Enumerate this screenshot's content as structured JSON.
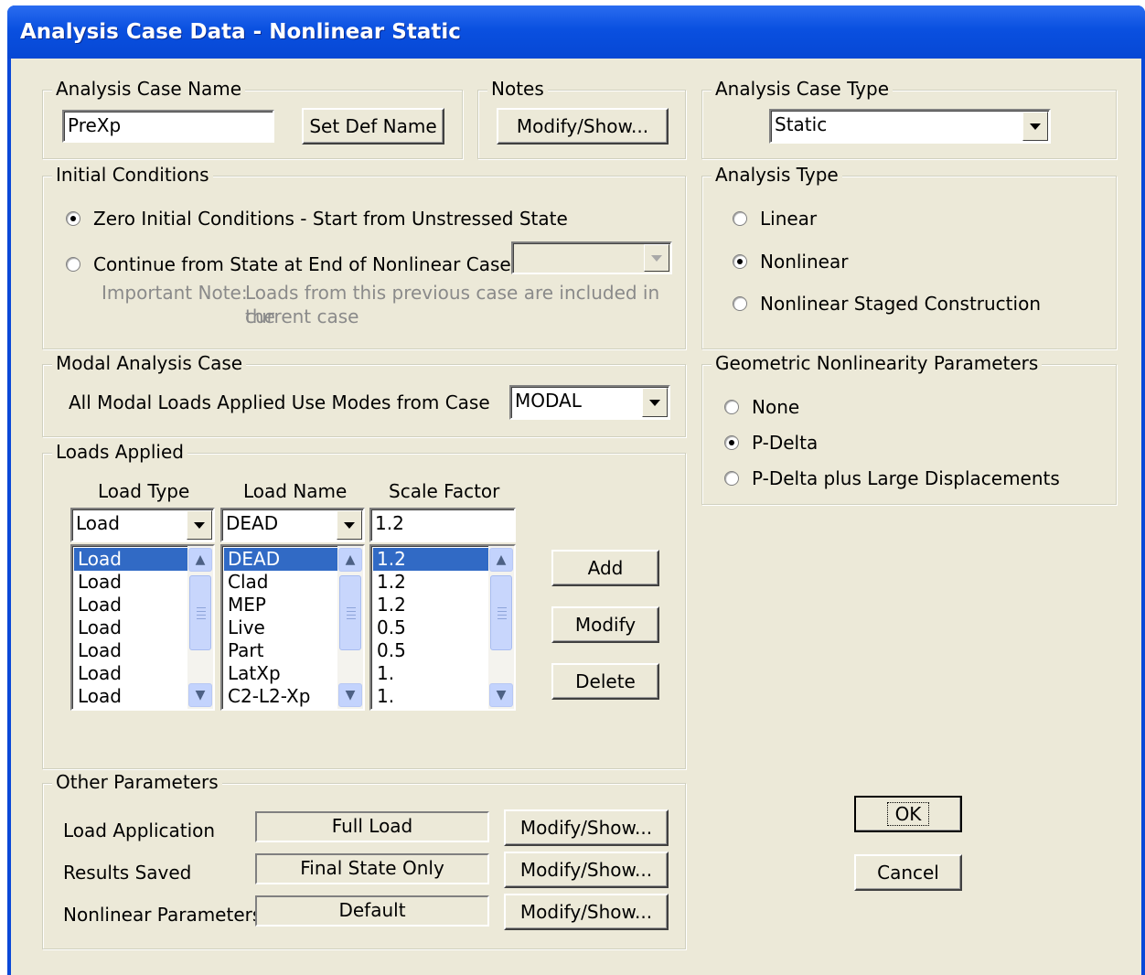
{
  "window": {
    "title": "Analysis Case Data - Nonlinear Static"
  },
  "analysis_case_name": {
    "legend": "Analysis Case Name",
    "value": "PreXp",
    "set_def_name_label": "Set Def Name"
  },
  "notes": {
    "legend": "Notes",
    "button_label": "Modify/Show..."
  },
  "analysis_case_type": {
    "legend": "Analysis Case Type",
    "selected": "Static"
  },
  "initial_conditions": {
    "legend": "Initial Conditions",
    "option_zero": "Zero Initial Conditions - Start from Unstressed State",
    "option_continue": "Continue from State at End of Nonlinear Case",
    "selected": "zero",
    "note_label": "Important Note:",
    "note_line1": "Loads from this previous case are included in the",
    "note_line2": "current case"
  },
  "analysis_type": {
    "legend": "Analysis Type",
    "options": [
      "Linear",
      "Nonlinear",
      "Nonlinear Staged Construction"
    ],
    "selected": "Nonlinear"
  },
  "modal_analysis_case": {
    "legend": "Modal Analysis Case",
    "label": "All Modal Loads Applied Use Modes from Case",
    "selected": "MODAL"
  },
  "geometric_nonlinearity": {
    "legend": "Geometric Nonlinearity Parameters",
    "options": [
      "None",
      "P-Delta",
      "P-Delta plus Large Displacements"
    ],
    "selected": "P-Delta"
  },
  "loads_applied": {
    "legend": "Loads Applied",
    "headers": [
      "Load Type",
      "Load Name",
      "Scale Factor"
    ],
    "current": {
      "load_type": "Load",
      "load_name": "DEAD",
      "scale_factor": "1.2"
    },
    "rows": [
      {
        "load_type": "Load",
        "load_name": "DEAD",
        "scale_factor": "1.2"
      },
      {
        "load_type": "Load",
        "load_name": "Clad",
        "scale_factor": "1.2"
      },
      {
        "load_type": "Load",
        "load_name": "MEP",
        "scale_factor": "1.2"
      },
      {
        "load_type": "Load",
        "load_name": "Live",
        "scale_factor": "0.5"
      },
      {
        "load_type": "Load",
        "load_name": "Part",
        "scale_factor": "0.5"
      },
      {
        "load_type": "Load",
        "load_name": "LatXp",
        "scale_factor": "1."
      },
      {
        "load_type": "Load",
        "load_name": "C2-L2-Xp",
        "scale_factor": "1."
      }
    ],
    "add_label": "Add",
    "modify_label": "Modify",
    "delete_label": "Delete"
  },
  "other_parameters": {
    "legend": "Other Parameters",
    "rows": [
      {
        "label": "Load Application",
        "value": "Full Load",
        "button": "Modify/Show..."
      },
      {
        "label": "Results Saved",
        "value": "Final State Only",
        "button": "Modify/Show..."
      },
      {
        "label": "Nonlinear Parameters",
        "value": "Default",
        "button": "Modify/Show..."
      }
    ]
  },
  "dialog_buttons": {
    "ok_label": "OK",
    "cancel_label": "Cancel"
  },
  "colors": {
    "title_bar": "#0a50e0",
    "dialog_bg": "#ece9d8",
    "selection": "#316ac5"
  }
}
